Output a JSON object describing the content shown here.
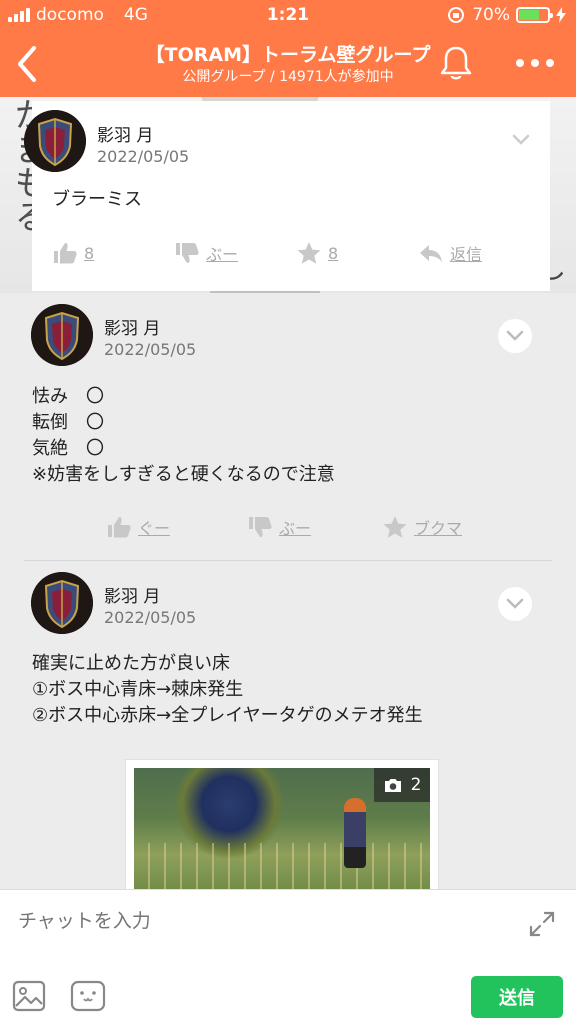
{
  "status_bar": {
    "carrier": "docomo",
    "network": "4G",
    "time": "1:21",
    "battery_percent": "70%",
    "battery_level": 0.7
  },
  "nav": {
    "title": "【TORAM】トーラム壁グループ",
    "subtitle": "公開グループ / 14971人が参加中",
    "back_icon": "chevron-left-icon",
    "bell_icon": "bell-icon",
    "more_icon": "more-dots-icon"
  },
  "wall_bg": {
    "vertical_text": "かまもる",
    "side_text": "とし"
  },
  "posts": [
    {
      "user": "影羽 月",
      "date": "2022/05/05",
      "text": "ブラーミス",
      "actions": {
        "like": "8",
        "dislike": "ぶー",
        "star": "8",
        "reply": "返信"
      }
    },
    {
      "user": "影羽 月",
      "date": "2022/05/05",
      "text": "怯み　〇\n転倒　〇\n気絶　〇\n※妨害をしすぎると硬くなるので注意",
      "actions": {
        "like": "ぐー",
        "dislike": "ぶー",
        "star": "ブクマ"
      }
    },
    {
      "user": "影羽 月",
      "date": "2022/05/05",
      "text": "確実に止めた方が良い床\n①ボス中心青床→棘床発生\n②ボス中心赤床→全プレイヤータゲのメテオ発生",
      "photo_count": "2"
    }
  ],
  "composer": {
    "placeholder": "チャットを入力",
    "send_label": "送信"
  },
  "colors": {
    "header": "#ff7a47",
    "send": "#22c25c",
    "battery": "#6be05a"
  }
}
